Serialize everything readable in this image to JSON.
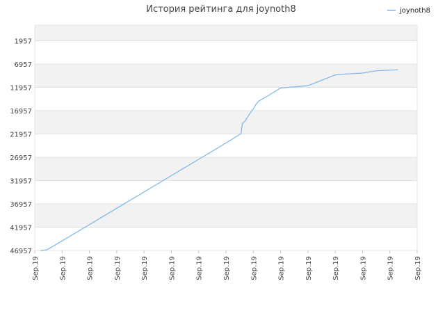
{
  "chart_data": {
    "type": "line",
    "title": "История рейтинга для joynoth8",
    "y_reversed": true,
    "ylim": [
      1957,
      46957
    ],
    "y_ticks": [
      1957,
      6957,
      11957,
      16957,
      21957,
      26957,
      31957,
      36957,
      41957,
      46957
    ],
    "y_tick_labels": [
      "1957",
      "6957",
      "11957",
      "16957",
      "21957",
      "26957",
      "31957",
      "36957",
      "41957",
      "46957"
    ],
    "x_tick_labels": [
      "Sep.19",
      "Sep.19",
      "Sep.19",
      "Sep.19",
      "Sep.19",
      "Sep.19",
      "Sep.19",
      "Sep.19",
      "Sep.19",
      "Sep.19",
      "Sep.19",
      "Sep.19",
      "Sep.19",
      "Sep.19",
      "Sep.19"
    ],
    "xlim": [
      0,
      14
    ],
    "legend_position": "top-right",
    "grid": true,
    "series": [
      {
        "name": "joynoth8",
        "color": "#7cb5ec",
        "x": [
          0.2,
          0.45,
          1.0,
          2.0,
          3.0,
          4.0,
          5.0,
          6.0,
          7.0,
          7.55,
          7.6,
          7.7,
          7.85,
          8.0,
          8.1,
          8.2,
          8.5,
          9.0,
          10.0,
          11.0,
          11.1,
          12.0,
          12.5,
          13.3
        ],
        "y": [
          46957,
          46800,
          44900,
          41400,
          37900,
          34400,
          30900,
          27400,
          23900,
          21900,
          19700,
          19200,
          17800,
          16600,
          15600,
          14900,
          13900,
          12100,
          11600,
          9300,
          9200,
          8900,
          8400,
          8200
        ]
      }
    ]
  }
}
